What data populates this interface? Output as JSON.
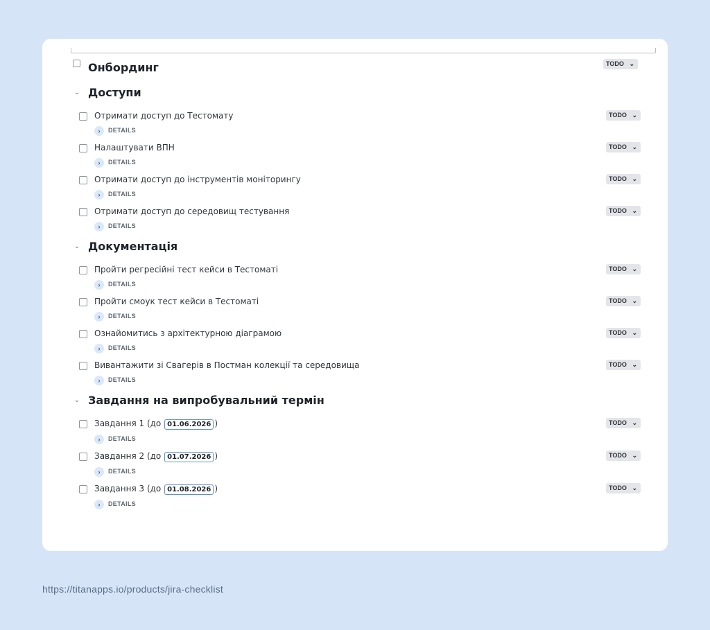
{
  "checklist": {
    "root_title": "Онбординг",
    "root_status": "TODO",
    "details_label": "DETAILS",
    "sections": [
      {
        "title": "Доступи",
        "items": [
          {
            "text": "Отримати доступ до Тестомату",
            "status": "TODO"
          },
          {
            "text": "Налаштувати ВПН",
            "status": "TODO"
          },
          {
            "text": "Отримати доступ до інструментів моніторингу",
            "status": "TODO"
          },
          {
            "text": "Отримати доступ до середовищ тестування",
            "status": "TODO"
          }
        ]
      },
      {
        "title": "Документація",
        "items": [
          {
            "text": "Пройти регресійні тест кейси в Тестоматі",
            "status": "TODO"
          },
          {
            "text": "Пройти смоук тест кейси в Тестоматі",
            "status": "TODO"
          },
          {
            "text": "Ознайомитись з архітектурною діаграмою",
            "status": "TODO"
          },
          {
            "text": "Вивантажити зі Свагерів в Постман колекції та середовища",
            "status": "TODO"
          }
        ]
      },
      {
        "title": "Завдання на випробувальний термін",
        "items": [
          {
            "text": "Завдання 1 (до ",
            "date": "01.06.2026",
            "text_end": ")",
            "status": "TODO"
          },
          {
            "text": "Завдання 2 (до ",
            "date": "01.07.2026",
            "text_end": ")",
            "status": "TODO"
          },
          {
            "text": "Завдання 3 (до ",
            "date": "01.08.2026",
            "text_end": ")",
            "status": "TODO"
          }
        ]
      }
    ]
  },
  "footer": {
    "url": "https://titanapps.io/products/jira-checklist"
  },
  "icons": {
    "chevron": "chevron-down-icon",
    "details": "chevron-right-icon",
    "status_caret": "chevron-down-icon"
  }
}
